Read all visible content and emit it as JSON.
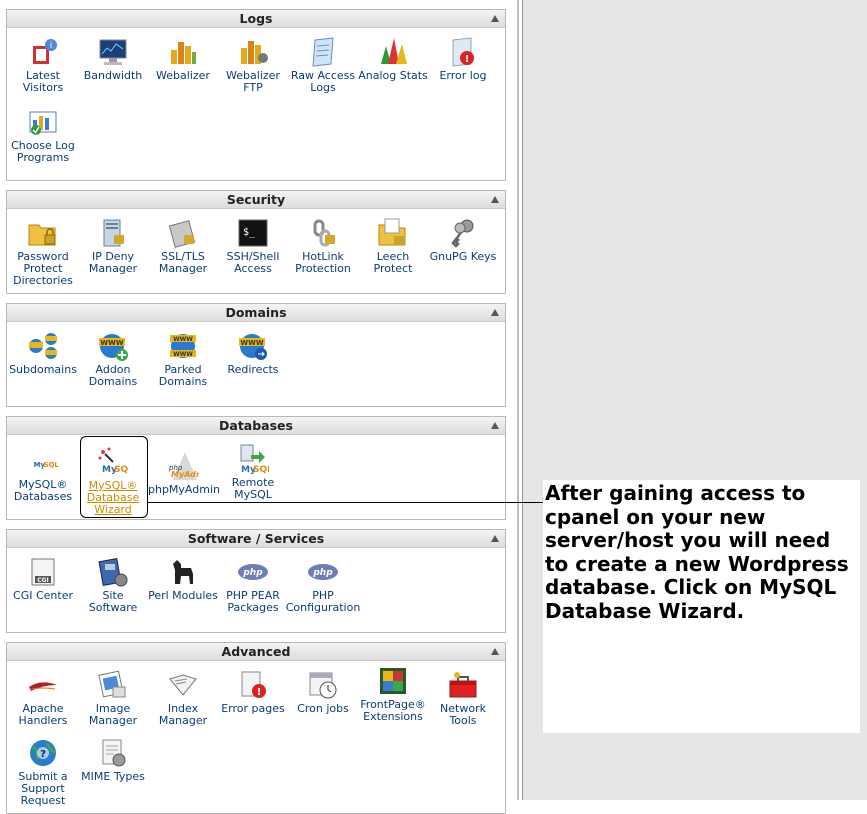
{
  "sections": [
    {
      "title": "Logs",
      "items": [
        {
          "label": "Latest Visitors",
          "icon": "latest-visitors-icon"
        },
        {
          "label": "Bandwidth",
          "icon": "bandwidth-icon"
        },
        {
          "label": "Webalizer",
          "icon": "webalizer-icon"
        },
        {
          "label": "Webalizer FTP",
          "icon": "webalizer-ftp-icon"
        },
        {
          "label": "Raw Access Logs",
          "icon": "raw-access-logs-icon"
        },
        {
          "label": "Analog Stats",
          "icon": "analog-stats-icon"
        },
        {
          "label": "Error log",
          "icon": "error-log-icon"
        },
        {
          "label": "Choose Log Programs",
          "icon": "choose-log-programs-icon"
        }
      ]
    },
    {
      "title": "Security",
      "items": [
        {
          "label": "Password Protect Directories",
          "icon": "password-protect-icon"
        },
        {
          "label": "IP Deny Manager",
          "icon": "ip-deny-icon"
        },
        {
          "label": "SSL/TLS Manager",
          "icon": "ssl-tls-icon"
        },
        {
          "label": "SSH/Shell Access",
          "icon": "ssh-shell-icon"
        },
        {
          "label": "HotLink Protection",
          "icon": "hotlink-icon"
        },
        {
          "label": "Leech Protect",
          "icon": "leech-protect-icon"
        },
        {
          "label": "GnuPG Keys",
          "icon": "gnupg-keys-icon"
        }
      ]
    },
    {
      "title": "Domains",
      "items": [
        {
          "label": "Subdomains",
          "icon": "subdomains-icon"
        },
        {
          "label": "Addon Domains",
          "icon": "addon-domains-icon"
        },
        {
          "label": "Parked Domains",
          "icon": "parked-domains-icon"
        },
        {
          "label": "Redirects",
          "icon": "redirects-icon"
        }
      ]
    },
    {
      "title": "Databases",
      "items": [
        {
          "label": "MySQL® Databases",
          "icon": "mysql-databases-icon"
        },
        {
          "label": "MySQL® Database Wizard",
          "icon": "mysql-wizard-icon"
        },
        {
          "label": "phpMyAdmin",
          "icon": "phpmyadmin-icon"
        },
        {
          "label": "Remote MySQL",
          "icon": "remote-mysql-icon"
        }
      ]
    },
    {
      "title": "Software / Services",
      "items": [
        {
          "label": "CGI Center",
          "icon": "cgi-center-icon"
        },
        {
          "label": "Site Software",
          "icon": "site-software-icon"
        },
        {
          "label": "Perl Modules",
          "icon": "perl-modules-icon"
        },
        {
          "label": "PHP PEAR Packages",
          "icon": "php-pear-icon"
        },
        {
          "label": "PHP Configuration",
          "icon": "php-config-icon"
        }
      ]
    },
    {
      "title": "Advanced",
      "items": [
        {
          "label": "Apache Handlers",
          "icon": "apache-handlers-icon"
        },
        {
          "label": "Image Manager",
          "icon": "image-manager-icon"
        },
        {
          "label": "Index Manager",
          "icon": "index-manager-icon"
        },
        {
          "label": "Error pages",
          "icon": "error-pages-icon"
        },
        {
          "label": "Cron jobs",
          "icon": "cron-jobs-icon"
        },
        {
          "label": "FrontPage® Extensions",
          "icon": "frontpage-icon"
        },
        {
          "label": "Network Tools",
          "icon": "network-tools-icon"
        },
        {
          "label": "Submit a Support Request",
          "icon": "support-request-icon"
        },
        {
          "label": "MIME Types",
          "icon": "mime-types-icon"
        }
      ]
    }
  ],
  "callout": {
    "text": "After gaining access to cpanel on your new server/host you will need to create a new Wordpress database. Click on MySQL Database Wizard."
  },
  "colors": {
    "link": "#0a3d78",
    "highlight_label": "#d08a00",
    "header_bg": "#dcdcdc",
    "right_bg": "#e6e6e6"
  }
}
